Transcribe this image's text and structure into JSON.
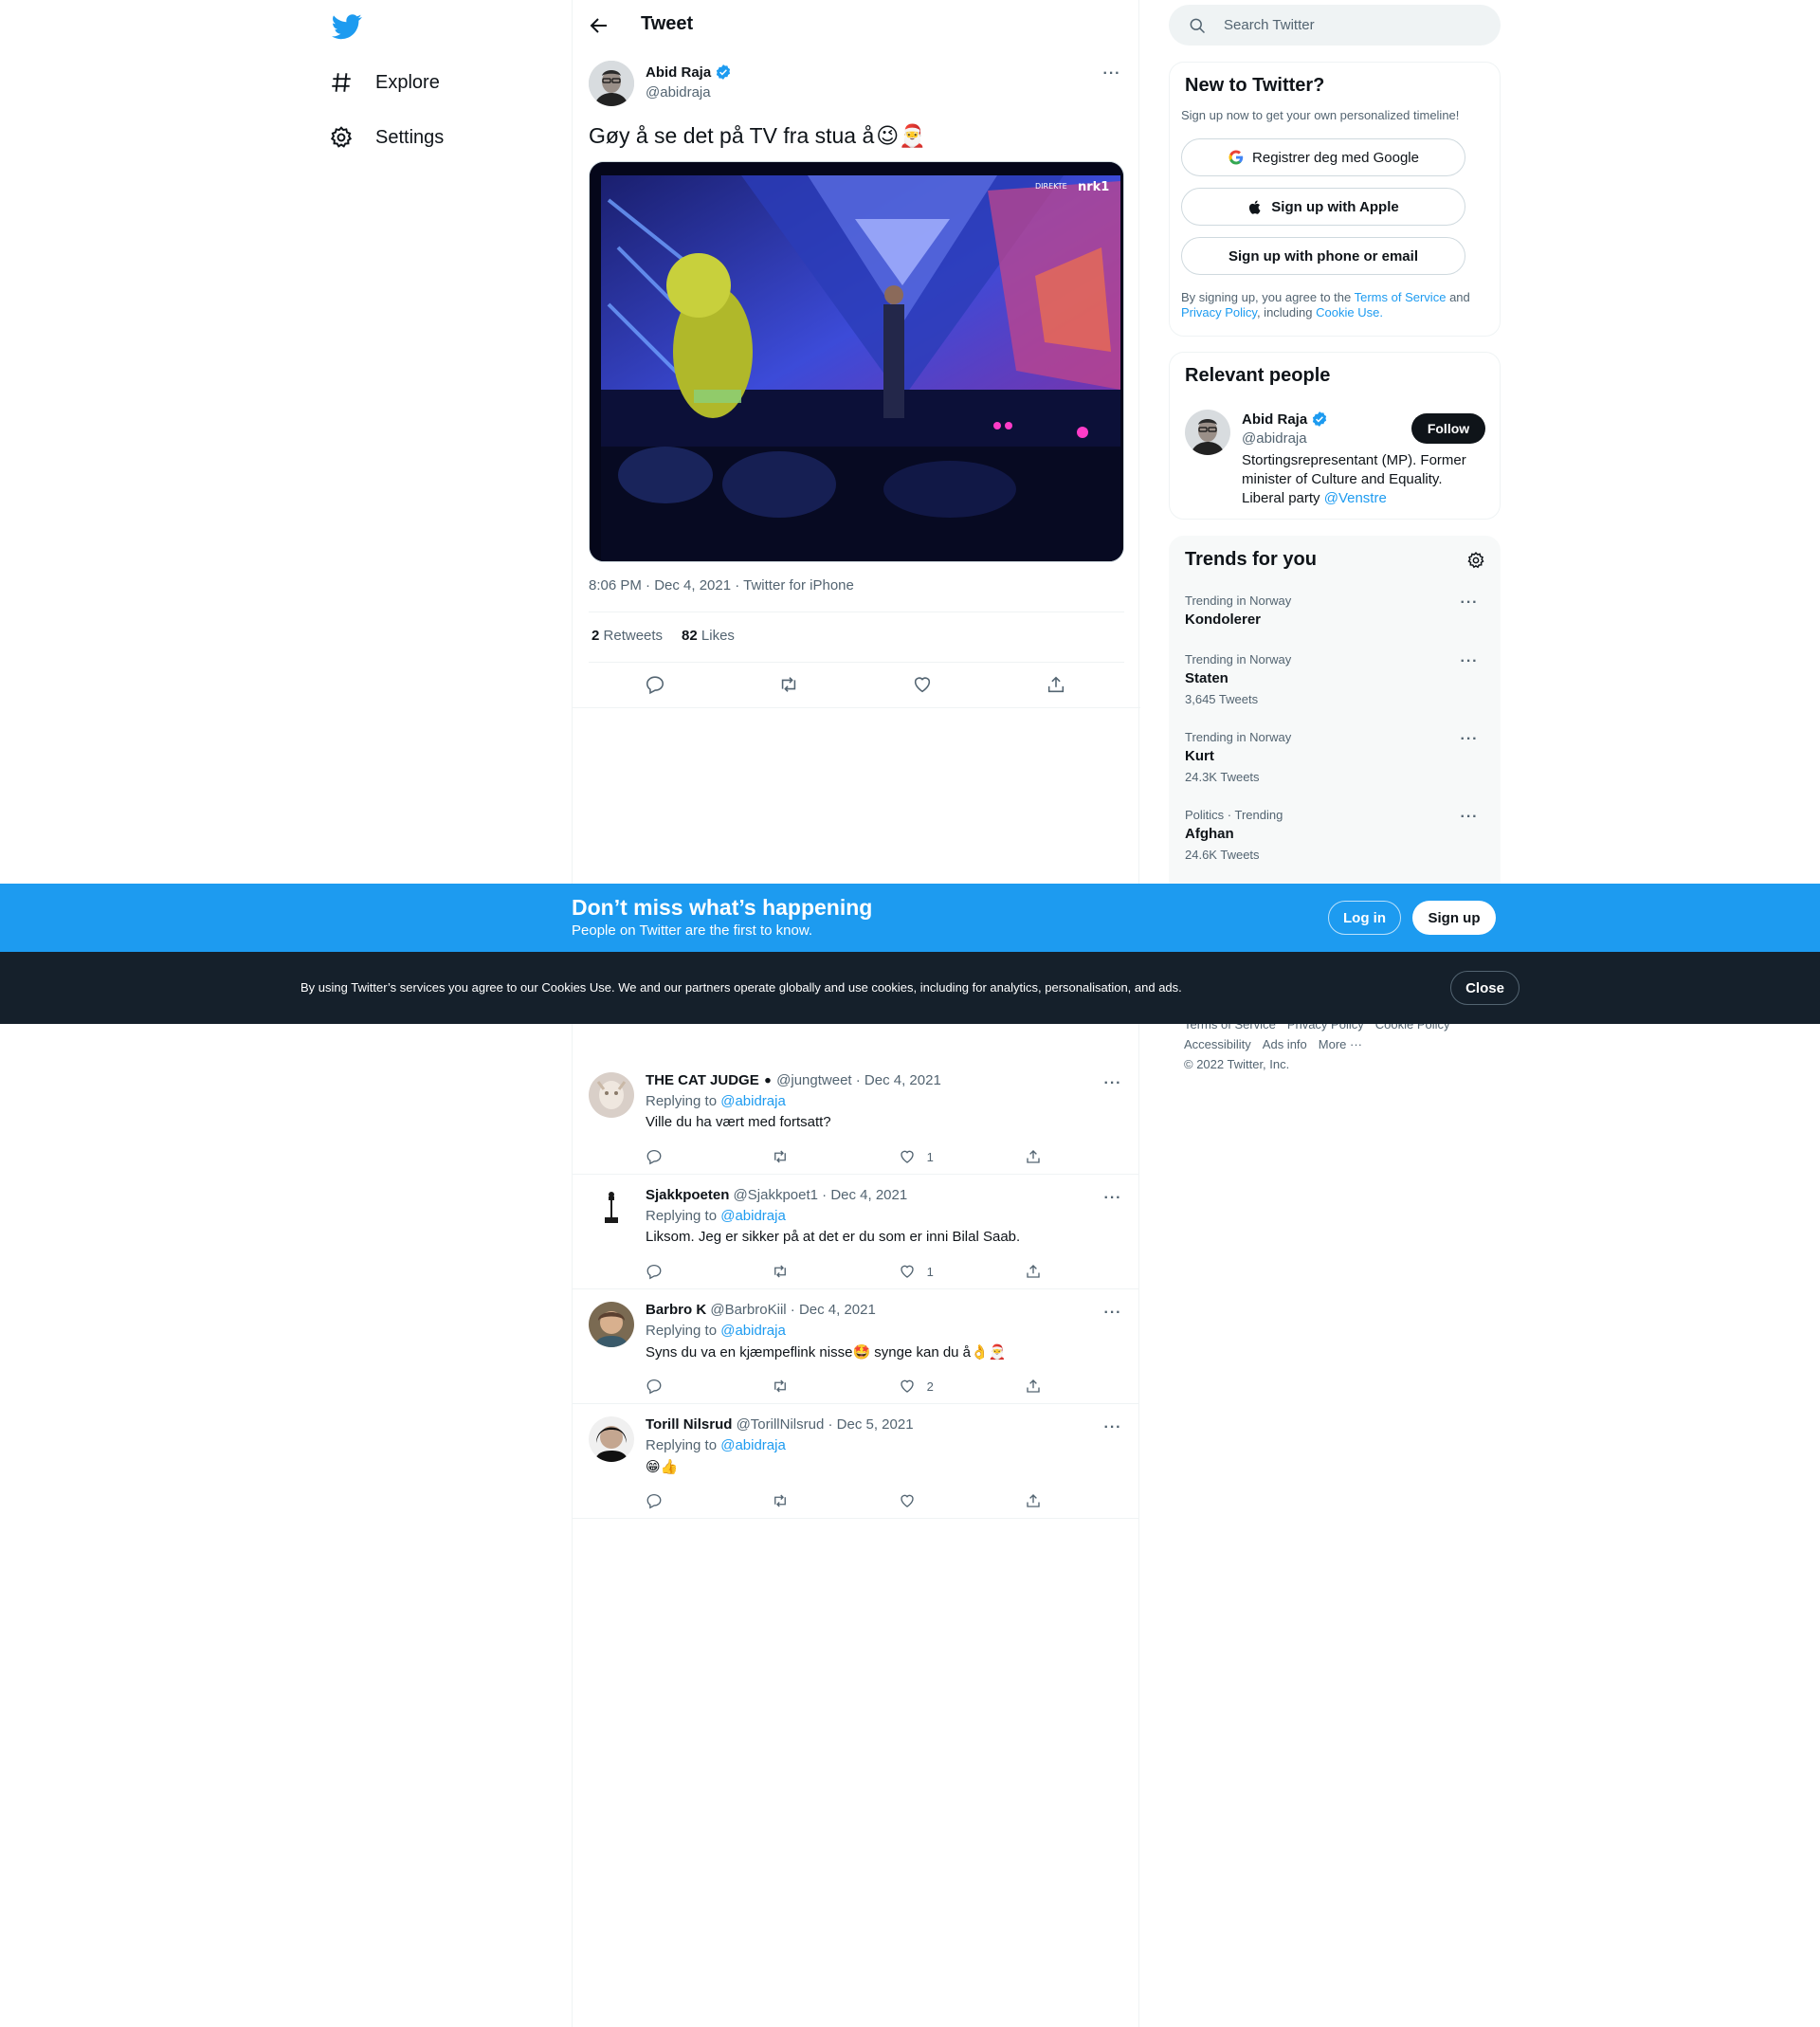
{
  "nav": {
    "items": [
      {
        "label": "Explore"
      },
      {
        "label": "Settings"
      }
    ]
  },
  "header": {
    "title": "Tweet"
  },
  "tweet": {
    "author_name": "Abid Raja",
    "author_handle": "@abidraja",
    "text": "Gøy å se det på TV fra stua å",
    "text_emoji": "😉🎅",
    "media_watermark": "DIREKTE",
    "media_channel": "nrk1",
    "meta": "8:06 PM · Dec 4, 2021 · Twitter for iPhone",
    "retweets_count": "2",
    "retweets_label": "Retweets",
    "likes_count": "82",
    "likes_label": "Likes"
  },
  "replies": [
    {
      "name": "THE CAT JUDGE",
      "suffix": "⚫",
      "handle_date": "@jungtweet · Dec 4, 2021",
      "replying_label": "Replying to",
      "replying_to": "@abidraja",
      "text": "Ville du ha vært med fortsatt?",
      "likes": "1"
    },
    {
      "name": "Sjakkpoeten",
      "suffix": "",
      "handle_date": "@Sjakkpoet1 · Dec 4, 2021",
      "replying_label": "Replying to",
      "replying_to": "@abidraja",
      "text": "Liksom. Jeg er sikker på at det er du som er inni Bilal Saab.",
      "likes": "1"
    },
    {
      "name": "Barbro K",
      "suffix": "",
      "handle_date": "@BarbroKiil · Dec 4, 2021",
      "replying_label": "Replying to",
      "replying_to": "@abidraja",
      "text": "Syns du va en kjæmpeflink nisse🤩 synge kan du å👌🎅",
      "likes": "2"
    },
    {
      "name": "Torill Nilsrud",
      "suffix": "",
      "handle_date": "@TorillNilsrud · Dec 5, 2021",
      "replying_label": "Replying to",
      "replying_to": "@abidraja",
      "text": "😁👍",
      "likes": ""
    }
  ],
  "search": {
    "placeholder": "Search Twitter"
  },
  "new_to_twitter": {
    "title": "New to Twitter?",
    "subtitle": "Sign up now to get your own personalized timeline!",
    "google_label": "Registrer deg med Google",
    "apple_label": "Sign up with Apple",
    "phone_label": "Sign up with phone or email",
    "legal_prefix": "By signing up, you agree to the",
    "tos": "Terms of Service",
    "and": "and",
    "privacy": "Privacy Policy",
    "including": ", including",
    "cookie_use": "Cookie Use."
  },
  "relevant": {
    "title": "Relevant people",
    "name": "Abid Raja",
    "handle": "@abidraja",
    "follow_label": "Follow",
    "bio": "Stortingsrepresentant (MP). Former minister of Culture and Equality. Liberal party",
    "bio_link": "@Venstre"
  },
  "trends": {
    "title": "Trends for you",
    "items": [
      {
        "context": "Trending in Norway",
        "name": "Kondolerer",
        "count": ""
      },
      {
        "context": "Trending in Norway",
        "name": "Staten",
        "count": "3,645 Tweets"
      },
      {
        "context": "Trending in Norway",
        "name": "Kurt",
        "count": "24.3K Tweets"
      },
      {
        "context": "Politics · Trending",
        "name": "Afghan",
        "count": "24.6K Tweets"
      }
    ]
  },
  "footer": {
    "links_row1": [
      "Terms of Service",
      "Privacy Policy",
      "Cookie Policy"
    ],
    "links_row2": [
      "Accessibility",
      "Ads info",
      "More ···"
    ],
    "copyright": "© 2022 Twitter, Inc."
  },
  "promo": {
    "title": "Don’t miss what’s happening",
    "subtitle": "People on Twitter are the first to know.",
    "login_label": "Log in",
    "signup_label": "Sign up"
  },
  "cookie": {
    "message": "By using Twitter’s services you agree to our Cookies Use. We and our partners operate globally and use cookies, including for analytics, personalisation, and ads.",
    "close_label": "Close"
  },
  "colors": {
    "accent": "#1d9bf0",
    "text": "#0f1419",
    "muted": "#536471",
    "cookie_bg": "#15202b"
  }
}
